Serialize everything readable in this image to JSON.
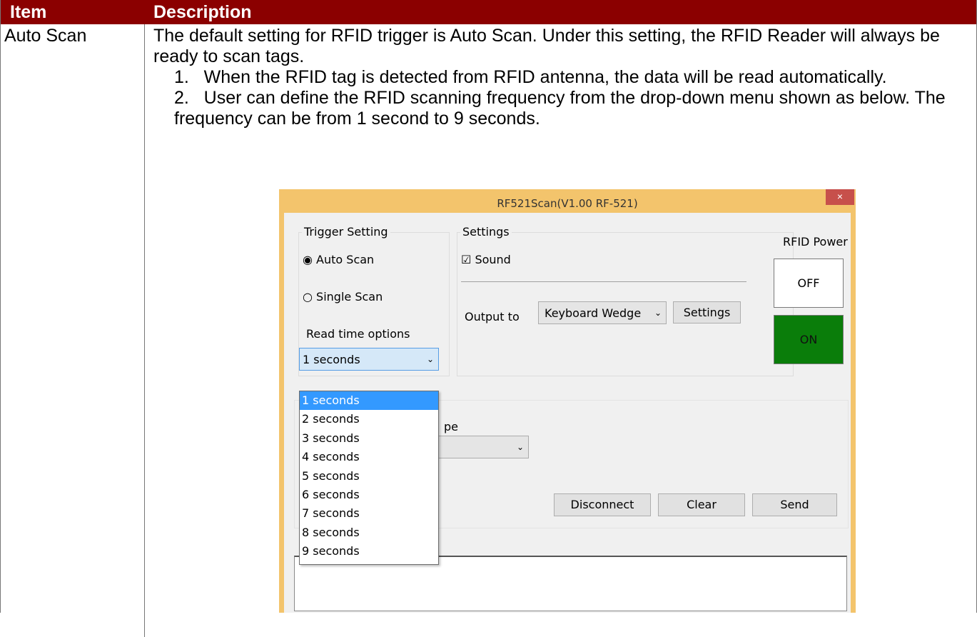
{
  "table": {
    "header_bg": "#8b0000",
    "col_item": "Item",
    "col_description": "Description",
    "row_item": "Auto Scan",
    "para1": "The default setting for RFID trigger is Auto Scan. Under this setting, the RFID Reader will always be ready to scan tags.",
    "step1": "1.   When the RFID tag is detected from RFID antenna, the data will be read automatically.",
    "step2": "2.   User can define the RFID scanning frequency from the drop-down menu shown as below. The frequency can be from 1 second to 9 seconds."
  },
  "dialog": {
    "title": "RF521Scan(V1.00 RF-521)",
    "close_glyph": "×",
    "trigger_group_title": "Trigger Setting",
    "auto_scan_label": "Auto Scan",
    "single_scan_label": "Single Scan",
    "read_time_label": "Read time options",
    "read_time_selected": "1 seconds",
    "read_time_options": [
      "1 seconds",
      "2 seconds",
      "3 seconds",
      "4 seconds",
      "5 seconds",
      "6 seconds",
      "7 seconds",
      "8 seconds",
      "9 seconds"
    ],
    "settings_group_title": "Settings",
    "sound_label": "Sound",
    "output_to_label": "Output to",
    "output_selected": "Keyboard Wedge",
    "settings_button": "Settings",
    "rfid_power_label": "RFID Power",
    "off_button": "OFF",
    "on_button": "ON",
    "on_color": "#0a7d0a",
    "partial_label": "pe",
    "disconnect_button": "Disconnect",
    "clear_button": "Clear",
    "send_button": "Send"
  }
}
